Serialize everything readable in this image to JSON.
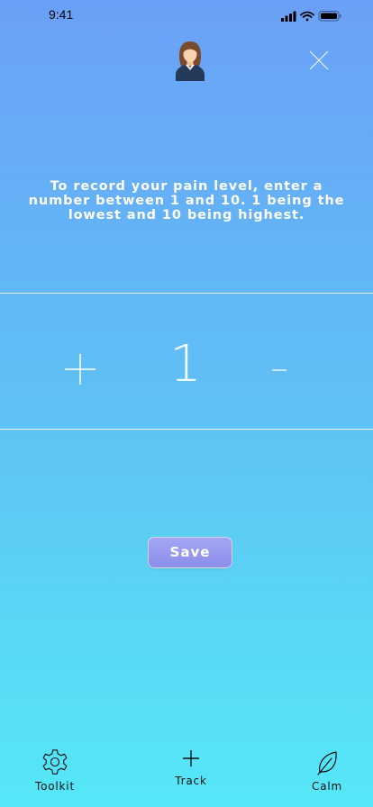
{
  "status_bar": {
    "time": "9:41"
  },
  "header": {
    "avatar_icon": "person-avatar-icon",
    "close_icon": "close-icon"
  },
  "instructions": "To record your pain level, enter a number between 1 and 10. 1 being the lowest and 10 being highest.",
  "pain_input": {
    "value": "1",
    "increment_icon": "plus-icon",
    "decrement_icon": "minus-icon"
  },
  "save_label": "Save",
  "tab_bar": {
    "items": [
      {
        "label": "Toolkit",
        "icon": "gear-icon"
      },
      {
        "label": "Track",
        "icon": "plus-icon"
      },
      {
        "label": "Calm",
        "icon": "leaf-icon"
      }
    ]
  },
  "colors": {
    "gradient_top": "#6aa0f7",
    "gradient_bottom": "#55e8f8",
    "button": "#9497ee"
  }
}
